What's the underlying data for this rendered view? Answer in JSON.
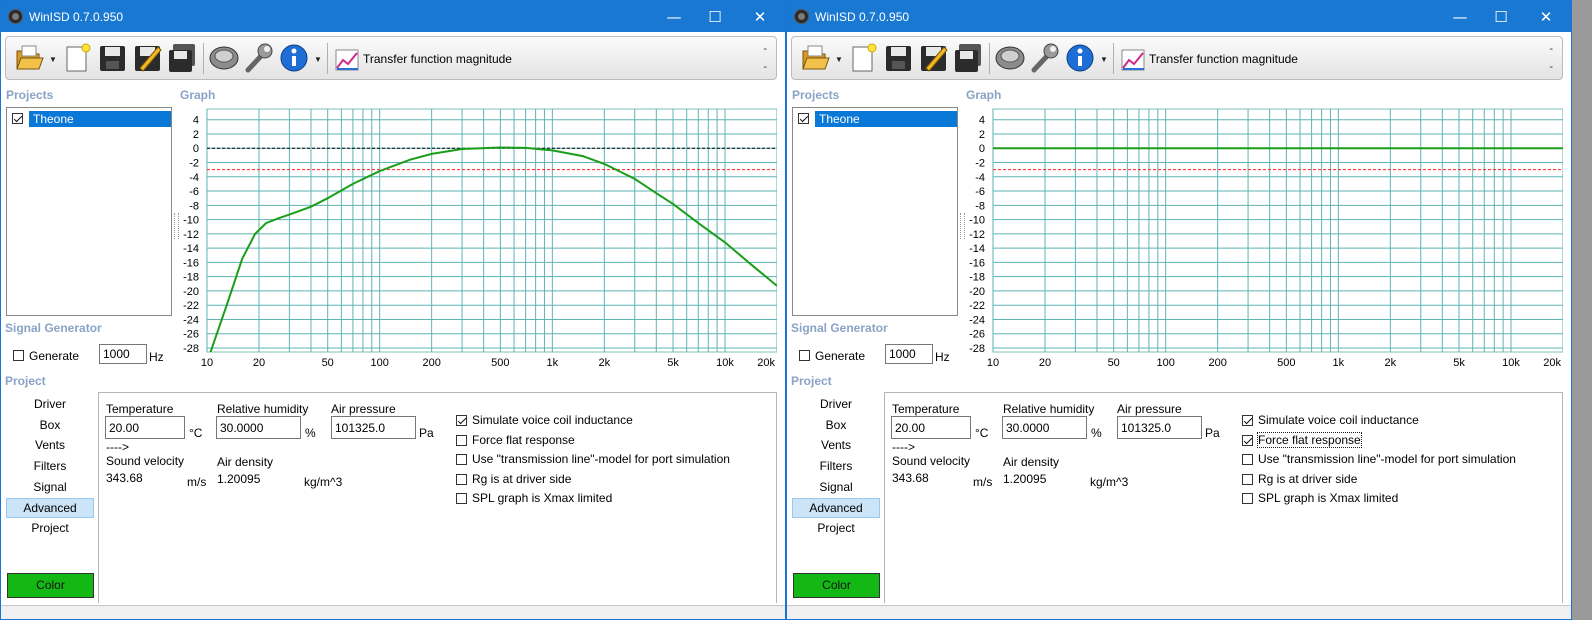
{
  "windows": [
    {
      "id": "left",
      "x": 0,
      "title": "WinISD 0.7.0.950",
      "toolbar": {
        "view_label": "Transfer function magnitude",
        "dash_top": "-",
        "dash_bottom": "-"
      },
      "projects": {
        "title": "Projects",
        "items": [
          {
            "name": "Theone",
            "checked": true
          }
        ]
      },
      "graph_title": "Graph",
      "signal_generator": {
        "title": "Signal Generator",
        "generate_label": "Generate",
        "generate_checked": false,
        "frequency": "1000",
        "unit": "Hz"
      },
      "project_section": {
        "title": "Project",
        "nav": [
          "Driver",
          "Box",
          "Vents",
          "Filters",
          "Signal",
          "Advanced",
          "Project"
        ],
        "selected": "Advanced",
        "color_button": "Color"
      },
      "advanced": {
        "temperature_label": "Temperature",
        "temperature": "20.00",
        "temperature_unit": "°C",
        "humidity_label": "Relative humidity",
        "humidity": "30.0000",
        "humidity_unit": "%",
        "pressure_label": "Air pressure",
        "pressure": "101325.0",
        "pressure_unit": "Pa",
        "arrow": "---->",
        "sound_velocity_label": "Sound velocity",
        "sound_velocity": "343.68",
        "sound_velocity_unit": "m/s",
        "air_density_label": "Air density",
        "air_density": "1.20095",
        "air_density_unit": "kg/m^3",
        "options": [
          {
            "label": "Simulate voice coil inductance",
            "checked": true
          },
          {
            "label": "Force flat response",
            "checked": false
          },
          {
            "label": "Use \"transmission line\"-model for port simulation",
            "checked": false
          },
          {
            "label": "Rg is at driver side",
            "checked": false
          },
          {
            "label": "SPL graph is Xmax limited",
            "checked": false
          }
        ]
      },
      "chart_data": {
        "type": "line",
        "x_scale": "log",
        "xlim": [
          10,
          20000
        ],
        "ylim": [
          -28,
          4
        ],
        "x_ticks": [
          "10",
          "20",
          "50",
          "100",
          "200",
          "500",
          "1k",
          "2k",
          "5k",
          "10k",
          "20k"
        ],
        "y_ticks": [
          "4",
          "2",
          "0",
          "-2",
          "-4",
          "-6",
          "-8",
          "-10",
          "-12",
          "-14",
          "-16",
          "-18",
          "-20",
          "-22",
          "-24",
          "-26",
          "-28"
        ],
        "reference_lines": [
          {
            "y": 0,
            "color": "#000000",
            "style": "dashed"
          },
          {
            "y": -3,
            "color": "#ff2020",
            "style": "dashed"
          }
        ],
        "series": [
          {
            "color": "#1a9e1a",
            "points": [
              [
                10,
                -30
              ],
              [
                13,
                -22
              ],
              [
                16,
                -15.5
              ],
              [
                19,
                -12
              ],
              [
                22,
                -10.5
              ],
              [
                26,
                -9.8
              ],
              [
                30,
                -9.3
              ],
              [
                40,
                -8.2
              ],
              [
                50,
                -7
              ],
              [
                70,
                -5
              ],
              [
                100,
                -3.2
              ],
              [
                150,
                -1.6
              ],
              [
                200,
                -0.8
              ],
              [
                300,
                -0.1
              ],
              [
                500,
                0.1
              ],
              [
                700,
                0.05
              ],
              [
                1000,
                -0.3
              ],
              [
                1500,
                -1.1
              ],
              [
                2000,
                -2.2
              ],
              [
                3000,
                -4.3
              ],
              [
                4000,
                -6.3
              ],
              [
                5000,
                -7.8
              ],
              [
                7000,
                -10.5
              ],
              [
                10000,
                -13.2
              ],
              [
                14000,
                -16.2
              ],
              [
                20000,
                -19.3
              ]
            ]
          }
        ]
      }
    },
    {
      "id": "right",
      "x": 786,
      "title": "WinISD 0.7.0.950",
      "toolbar": {
        "view_label": "Transfer function magnitude",
        "dash_top": "-",
        "dash_bottom": "-"
      },
      "projects": {
        "title": "Projects",
        "items": [
          {
            "name": "Theone",
            "checked": true
          }
        ]
      },
      "graph_title": "Graph",
      "signal_generator": {
        "title": "Signal Generator",
        "generate_label": "Generate",
        "generate_checked": false,
        "frequency": "1000",
        "unit": "Hz"
      },
      "project_section": {
        "title": "Project",
        "nav": [
          "Driver",
          "Box",
          "Vents",
          "Filters",
          "Signal",
          "Advanced",
          "Project"
        ],
        "selected": "Advanced",
        "color_button": "Color"
      },
      "advanced": {
        "temperature_label": "Temperature",
        "temperature": "20.00",
        "temperature_unit": "°C",
        "humidity_label": "Relative humidity",
        "humidity": "30.0000",
        "humidity_unit": "%",
        "pressure_label": "Air pressure",
        "pressure": "101325.0",
        "pressure_unit": "Pa",
        "arrow": "---->",
        "sound_velocity_label": "Sound velocity",
        "sound_velocity": "343.68",
        "sound_velocity_unit": "m/s",
        "air_density_label": "Air density",
        "air_density": "1.20095",
        "air_density_unit": "kg/m^3",
        "options": [
          {
            "label": "Simulate voice coil inductance",
            "checked": true
          },
          {
            "label": "Force flat response",
            "checked": true,
            "focused": true
          },
          {
            "label": "Use \"transmission line\"-model for port simulation",
            "checked": false
          },
          {
            "label": "Rg is at driver side",
            "checked": false
          },
          {
            "label": "SPL graph is Xmax limited",
            "checked": false
          }
        ]
      },
      "chart_data": {
        "type": "line",
        "x_scale": "log",
        "xlim": [
          10,
          20000
        ],
        "ylim": [
          -28,
          4
        ],
        "x_ticks": [
          "10",
          "20",
          "50",
          "100",
          "200",
          "500",
          "1k",
          "2k",
          "5k",
          "10k",
          "20k"
        ],
        "y_ticks": [
          "4",
          "2",
          "0",
          "-2",
          "-4",
          "-6",
          "-8",
          "-10",
          "-12",
          "-14",
          "-16",
          "-18",
          "-20",
          "-22",
          "-24",
          "-26",
          "-28"
        ],
        "reference_lines": [
          {
            "y": 0,
            "color": "#000000",
            "style": "dashed"
          },
          {
            "y": -3,
            "color": "#ff2020",
            "style": "dashed"
          }
        ],
        "series": [
          {
            "color": "#1a9e1a",
            "points": [
              [
                10,
                0
              ],
              [
                20000,
                0
              ]
            ]
          }
        ]
      }
    }
  ]
}
